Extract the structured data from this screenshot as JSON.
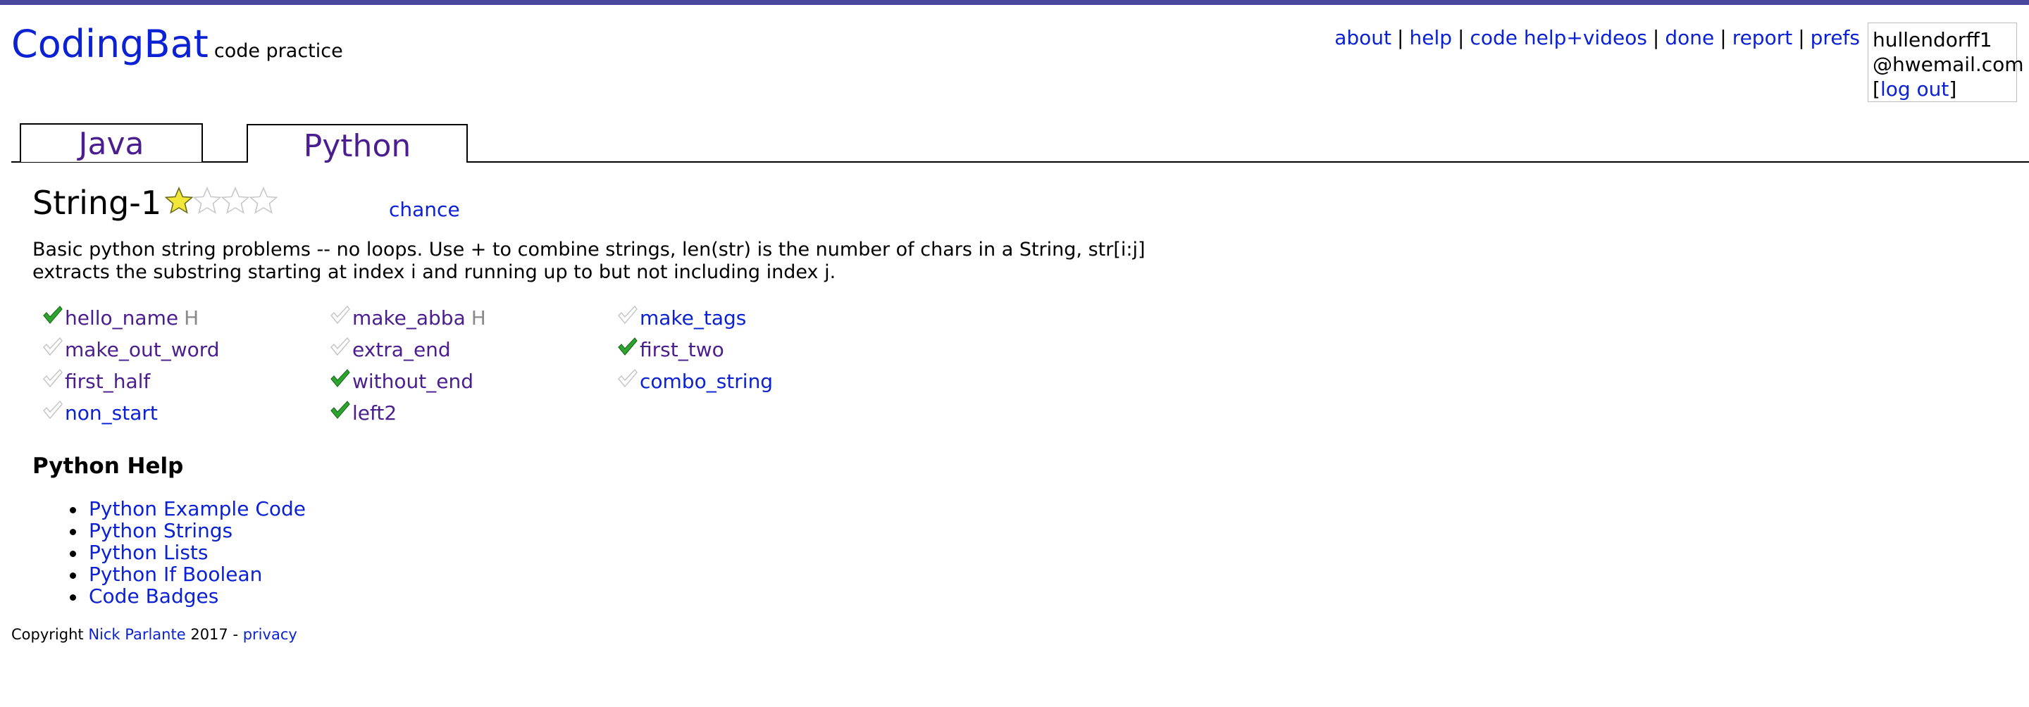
{
  "header": {
    "brand": "CodingBat",
    "tagline": "code practice",
    "nav": [
      "about",
      "help",
      "code help+videos",
      "done",
      "report",
      "prefs"
    ],
    "user": {
      "email_line1": "hullendorff1",
      "email_line2": "@hwemail.com",
      "logout_label": "log out"
    }
  },
  "tabs": [
    {
      "label": "Java"
    },
    {
      "label": "Python"
    }
  ],
  "section": {
    "title": "String-1",
    "stars_filled": 1,
    "stars_total": 4,
    "chance_label": "chance",
    "description": "Basic python string problems -- no loops. Use + to combine strings, len(str) is the number of chars in a String, str[i:j] extracts the substring starting at index i and running up to but not including index j."
  },
  "problems": [
    {
      "name": "hello_name",
      "done": true,
      "hint": "H",
      "visited": true
    },
    {
      "name": "make_out_word",
      "done": false,
      "hint": "",
      "visited": true
    },
    {
      "name": "first_half",
      "done": false,
      "hint": "",
      "visited": true
    },
    {
      "name": "non_start",
      "done": false,
      "hint": "",
      "visited": false
    },
    {
      "name": "make_abba",
      "done": false,
      "hint": "H",
      "visited": true
    },
    {
      "name": "extra_end",
      "done": false,
      "hint": "",
      "visited": true
    },
    {
      "name": "without_end",
      "done": true,
      "hint": "",
      "visited": true
    },
    {
      "name": "left2",
      "done": true,
      "hint": "",
      "visited": true
    },
    {
      "name": "make_tags",
      "done": false,
      "hint": "",
      "visited": false
    },
    {
      "name": "first_two",
      "done": true,
      "hint": "",
      "visited": true
    },
    {
      "name": "combo_string",
      "done": false,
      "hint": "",
      "visited": false
    }
  ],
  "help": {
    "title": "Python Help",
    "links": [
      "Python Example Code",
      "Python Strings",
      "Python Lists",
      "Python If Boolean",
      "Code Badges"
    ]
  },
  "footer": {
    "prefix": "Copyright",
    "author": "Nick Parlante",
    "year": "2017 -",
    "privacy": "privacy"
  },
  "colors": {
    "link": "#0b21d4",
    "visited": "#4a1e8f",
    "top_border": "#4a479c",
    "check_done": "#2fa32f",
    "star": "#f2e63a"
  }
}
